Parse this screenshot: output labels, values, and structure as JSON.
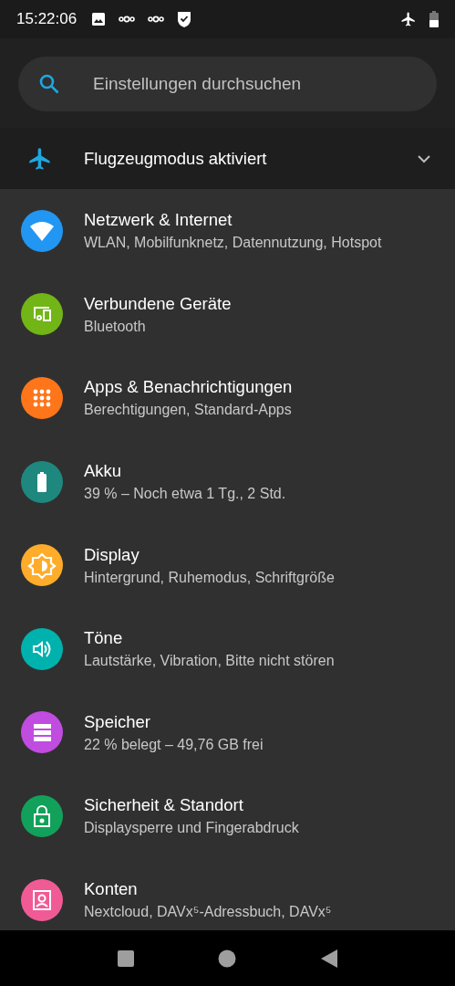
{
  "status_bar": {
    "time": "15:22:06"
  },
  "search": {
    "placeholder": "Einstellungen durchsuchen"
  },
  "banner": {
    "title": "Flugzeugmodus aktiviert",
    "expanded": false
  },
  "items": [
    {
      "kind": "wifi",
      "color": "#2196f3",
      "title": "Netzwerk & Internet",
      "summary": "WLAN, Mobilfunknetz, Datennutzung, Hotspot"
    },
    {
      "kind": "devices",
      "color": "#72b516",
      "title": "Verbundene Geräte",
      "summary": "Bluetooth"
    },
    {
      "kind": "apps",
      "color": "#ff7519",
      "title": "Apps & Benachrichtigungen",
      "summary": "Berechtigungen, Standard-Apps"
    },
    {
      "kind": "battery",
      "color": "#1e887e",
      "title": "Akku",
      "summary": "39 % – Noch etwa 1 Tg., 2 Std."
    },
    {
      "kind": "display",
      "color": "#feac2a",
      "title": "Display",
      "summary": "Hintergrund, Ruhemodus, Schriftgröße"
    },
    {
      "kind": "sound",
      "color": "#00b2ad",
      "title": "Töne",
      "summary": "Lautstärke, Vibration, Bitte nicht stören"
    },
    {
      "kind": "storage",
      "color": "#c04ce0",
      "title": "Speicher",
      "summary": "22 % belegt – 49,76 GB frei"
    },
    {
      "kind": "security",
      "color": "#12a15a",
      "title": "Sicherheit & Standort",
      "summary": "Displaysperre und Fingerabdruck"
    },
    {
      "kind": "accounts",
      "color": "#f05b95",
      "title": "Konten",
      "summary": "Nextcloud, DAVx⁵-Adressbuch, DAVx⁵"
    }
  ]
}
